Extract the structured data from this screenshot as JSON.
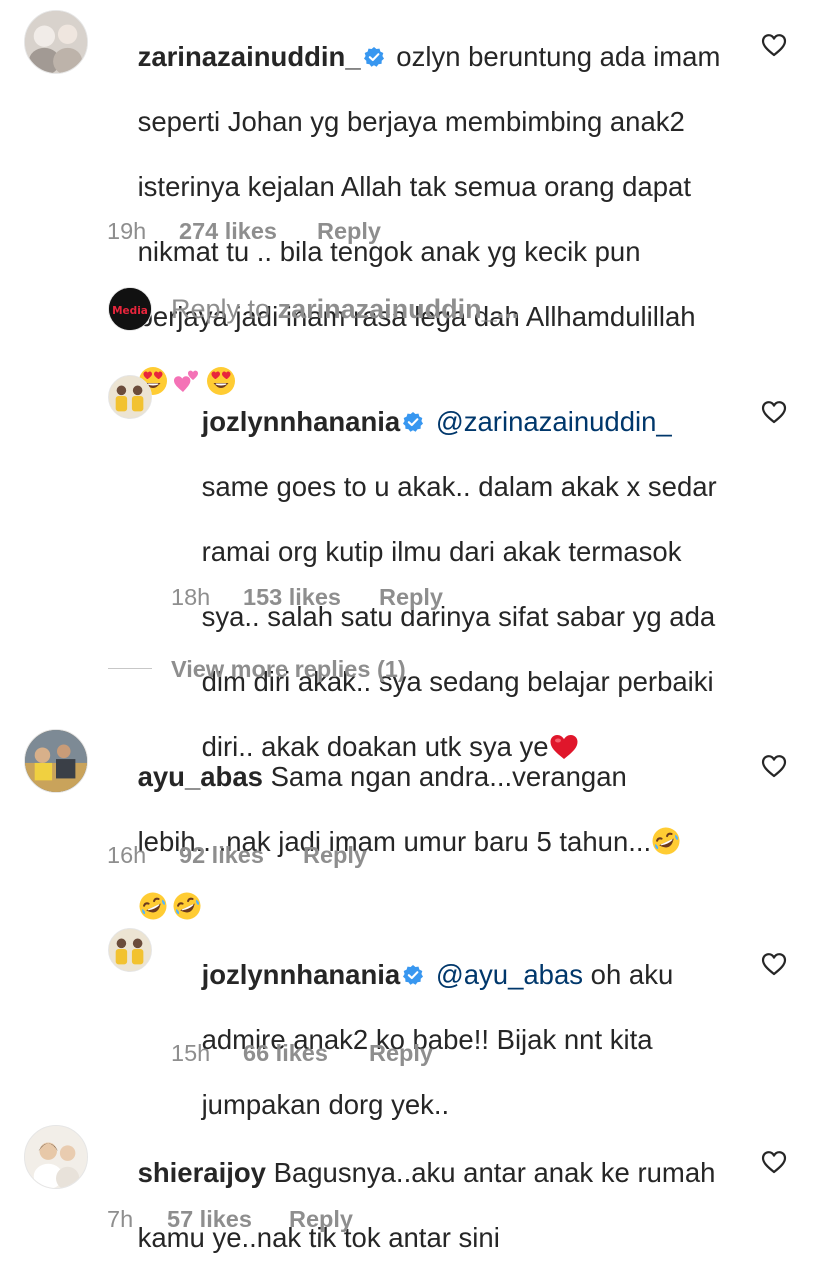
{
  "comments": [
    {
      "username": "zarinazainuddin_",
      "text_lines": [
        "ozlyn beruntung ada imam",
        "seperti Johan yg berjaya membimbing anak2",
        "isterinya kejalan Allah tak semua orang dapat",
        "nikmat tu .. bila tengok anak yg kecik pun",
        "berjaya jadi inam rasa lega dah Allhamdulillah"
      ],
      "emojis": [
        "heart-eyes-emoji",
        "two-hearts-emoji",
        "heart-eyes-emoji"
      ],
      "time": "19h",
      "likes": "274 likes",
      "reply_label": "Reply"
    },
    {
      "reply_to_prefix": "Reply to",
      "reply_to_user": "zarinazainuddin_...",
      "avatar_text": "Media"
    },
    {
      "username": "jozlynnhanania",
      "mention": "@zarinazainuddin_",
      "text_lines": [
        "same goes to u akak.. dalam akak x sedar",
        "ramai org kutip ilmu dari akak termasok",
        "sya.. salah satu darinya sifat sabar yg ada",
        "dlm diri akak.. sya sedang belajar perbaiki",
        "diri.. akak doakan utk sya ye"
      ],
      "time": "18h",
      "likes": "153 likes",
      "reply_label": "Reply"
    },
    {
      "view_more": "View more replies (1)"
    },
    {
      "username": "ayu_abas",
      "text_lines": [
        "Sama ngan andra...verangan",
        "lebih....nak jadi imam umur baru 5 tahun..."
      ],
      "time": "16h",
      "likes": "92 likes",
      "reply_label": "Reply"
    },
    {
      "username": "jozlynnhanania",
      "mention": "@ayu_abas",
      "text_lines": [
        "oh aku",
        "admire anak2 ko babe!! Bijak nnt kita",
        "jumpakan dorg yek.."
      ],
      "time": "15h",
      "likes": "66 likes",
      "reply_label": "Reply"
    },
    {
      "username": "shieraijoy",
      "text_lines": [
        "Bagusnya..aku antar anak ke rumah",
        "kamu ye..nak tik tok antar sini"
      ],
      "time": "7h",
      "likes": "57 likes",
      "reply_label": "Reply"
    }
  ],
  "colors": {
    "text": "#262626",
    "meta": "#8e8e8e",
    "mention": "#00376b",
    "verified": "#3897f0"
  }
}
